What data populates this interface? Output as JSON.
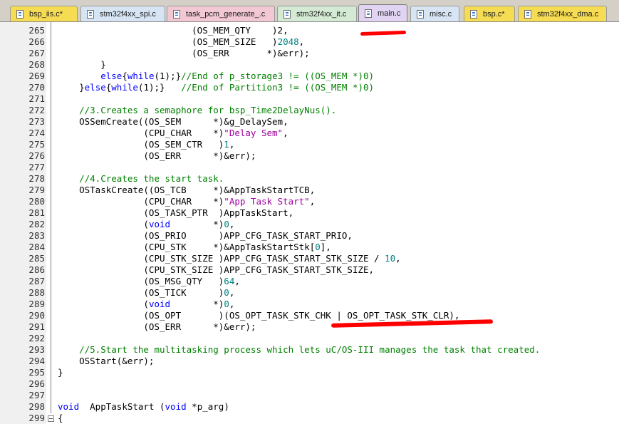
{
  "tabs": [
    {
      "label": "bsp_iis.c*",
      "bg": "#f6dc52",
      "active": false
    },
    {
      "label": "stm32f4xx_spi.c",
      "bg": "#d6e4f4",
      "active": false
    },
    {
      "label": "task_pcm_generate_.c",
      "bg": "#f2c8d4",
      "active": false
    },
    {
      "label": "stm32f4xx_it.c",
      "bg": "#d4ead4",
      "active": false
    },
    {
      "label": "main.c",
      "bg": "#e0d4f2",
      "active": true
    },
    {
      "label": "misc.c",
      "bg": "#d6e4f4",
      "active": false
    },
    {
      "label": "bsp.c*",
      "bg": "#f6dc52",
      "active": false
    },
    {
      "label": "stm32f4xx_dma.c",
      "bg": "#f6dc52",
      "active": false
    }
  ],
  "annotation_color": "#ff0000",
  "lines": [
    {
      "n": "265",
      "segs": [
        [
          "p",
          "                         (OS_MEM_QTY    )2,"
        ]
      ]
    },
    {
      "n": "266",
      "segs": [
        [
          "p",
          "                         (OS_MEM_SIZE   )"
        ],
        [
          "num",
          "2048"
        ],
        [
          "p",
          ","
        ]
      ]
    },
    {
      "n": "267",
      "segs": [
        [
          "p",
          "                         (OS_ERR       *)&err);"
        ]
      ]
    },
    {
      "n": "268",
      "segs": [
        [
          "p",
          "        }"
        ]
      ]
    },
    {
      "n": "269",
      "segs": [
        [
          "p",
          "        "
        ],
        [
          "kw",
          "else"
        ],
        [
          "p",
          "{"
        ],
        [
          "kw",
          "while"
        ],
        [
          "p",
          "(1);}"
        ],
        [
          "cm",
          "//End of p_storage3 != ((OS_MEM *)0)"
        ]
      ]
    },
    {
      "n": "270",
      "segs": [
        [
          "p",
          "    }"
        ],
        [
          "kw",
          "else"
        ],
        [
          "p",
          "{"
        ],
        [
          "kw",
          "while"
        ],
        [
          "p",
          "(1);}   "
        ],
        [
          "cm",
          "//End of Partition3 != ((OS_MEM *)0)"
        ]
      ]
    },
    {
      "n": "271",
      "segs": []
    },
    {
      "n": "272",
      "segs": [
        [
          "cm",
          "    //3.Creates a semaphore for bsp_Time2DelayNus()."
        ]
      ]
    },
    {
      "n": "273",
      "segs": [
        [
          "p",
          "    OSSemCreate((OS_SEM      *)&g_DelaySem,"
        ]
      ]
    },
    {
      "n": "274",
      "segs": [
        [
          "p",
          "                (CPU_CHAR    *)"
        ],
        [
          "str",
          "\"Delay Sem\""
        ],
        [
          "p",
          ","
        ]
      ]
    },
    {
      "n": "275",
      "segs": [
        [
          "p",
          "                (OS_SEM_CTR   )"
        ],
        [
          "num",
          "1"
        ],
        [
          "p",
          ","
        ]
      ]
    },
    {
      "n": "276",
      "segs": [
        [
          "p",
          "                (OS_ERR      *)&err);"
        ]
      ]
    },
    {
      "n": "277",
      "segs": []
    },
    {
      "n": "278",
      "segs": [
        [
          "cm",
          "    //4.Creates the start task."
        ]
      ]
    },
    {
      "n": "279",
      "segs": [
        [
          "p",
          "    OSTaskCreate((OS_TCB     *)&AppTaskStartTCB,"
        ]
      ]
    },
    {
      "n": "280",
      "segs": [
        [
          "p",
          "                (CPU_CHAR    *)"
        ],
        [
          "str",
          "\"App Task Start\""
        ],
        [
          "p",
          ","
        ]
      ]
    },
    {
      "n": "281",
      "segs": [
        [
          "p",
          "                (OS_TASK_PTR  )AppTaskStart,"
        ]
      ]
    },
    {
      "n": "282",
      "segs": [
        [
          "p",
          "                ("
        ],
        [
          "kw",
          "void"
        ],
        [
          "p",
          "        *)"
        ],
        [
          "num",
          "0"
        ],
        [
          "p",
          ","
        ]
      ]
    },
    {
      "n": "283",
      "segs": [
        [
          "p",
          "                (OS_PRIO      )APP_CFG_TASK_START_PRIO,"
        ]
      ]
    },
    {
      "n": "284",
      "segs": [
        [
          "p",
          "                (CPU_STK     *)&AppTaskStartStk["
        ],
        [
          "num",
          "0"
        ],
        [
          "p",
          "],"
        ]
      ]
    },
    {
      "n": "285",
      "segs": [
        [
          "p",
          "                (CPU_STK_SIZE )APP_CFG_TASK_START_STK_SIZE / "
        ],
        [
          "num",
          "10"
        ],
        [
          "p",
          ","
        ]
      ]
    },
    {
      "n": "286",
      "segs": [
        [
          "p",
          "                (CPU_STK_SIZE )APP_CFG_TASK_START_STK_SIZE,"
        ]
      ]
    },
    {
      "n": "287",
      "segs": [
        [
          "p",
          "                (OS_MSG_QTY   )"
        ],
        [
          "num",
          "64"
        ],
        [
          "p",
          ","
        ]
      ]
    },
    {
      "n": "288",
      "segs": [
        [
          "p",
          "                (OS_TICK      )"
        ],
        [
          "num",
          "0"
        ],
        [
          "p",
          ","
        ]
      ]
    },
    {
      "n": "289",
      "segs": [
        [
          "p",
          "                ("
        ],
        [
          "kw",
          "void"
        ],
        [
          "p",
          "        *)"
        ],
        [
          "num",
          "0"
        ],
        [
          "p",
          ","
        ]
      ]
    },
    {
      "n": "290",
      "segs": [
        [
          "p",
          "                (OS_OPT       )(OS_OPT_TASK_STK_CHK | OS_OPT_TASK_STK_CLR),"
        ]
      ]
    },
    {
      "n": "291",
      "segs": [
        [
          "p",
          "                (OS_ERR      *)&err);"
        ]
      ]
    },
    {
      "n": "292",
      "segs": []
    },
    {
      "n": "293",
      "segs": [
        [
          "cm",
          "    //5.Start the multitasking process which lets uC/OS-III manages the task that created."
        ]
      ]
    },
    {
      "n": "294",
      "segs": [
        [
          "p",
          "    OSStart(&err);"
        ]
      ]
    },
    {
      "n": "295",
      "segs": [
        [
          "p",
          "}"
        ]
      ]
    },
    {
      "n": "296",
      "segs": []
    },
    {
      "n": "297",
      "segs": []
    },
    {
      "n": "298",
      "segs": [
        [
          "kw",
          "void"
        ],
        [
          "p",
          "  AppTaskStart ("
        ],
        [
          "kw",
          "void"
        ],
        [
          "p",
          " *p_arg)"
        ]
      ]
    },
    {
      "n": "299",
      "segs": [
        [
          "p",
          "{"
        ]
      ]
    }
  ]
}
